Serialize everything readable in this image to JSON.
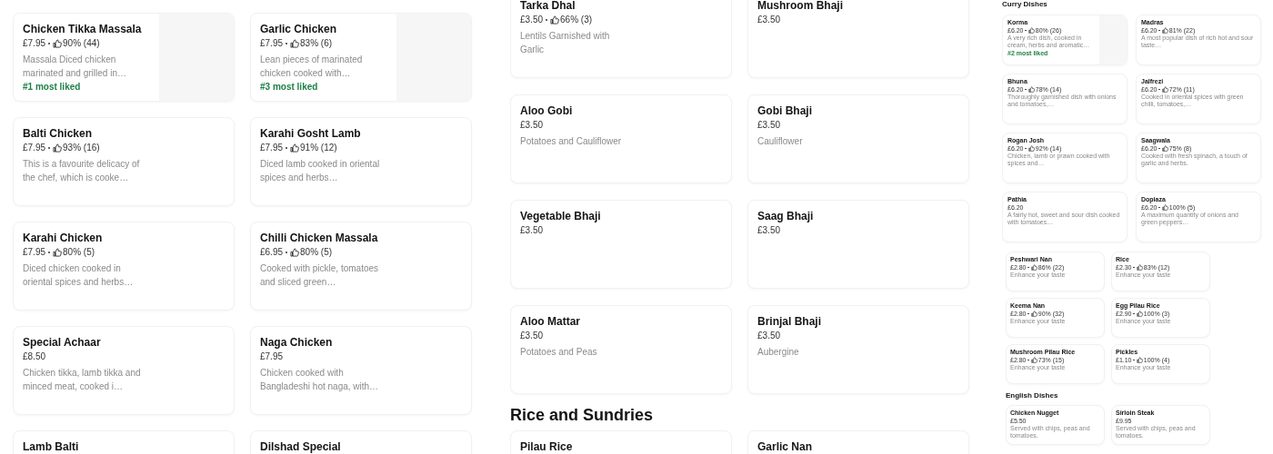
{
  "panels": [
    {
      "sections": [
        {
          "cards": [
            {
              "name": "Chicken Tikka Massala",
              "price": "£7.95",
              "rating": "90% (44)",
              "description": "Massala Diced chicken marinated and grilled in…",
              "badge": "#1 most liked",
              "photo": true
            },
            {
              "name": "Garlic Chicken",
              "price": "£7.95",
              "rating": "83% (6)",
              "description": "Lean pieces of marinated chicken cooked with…",
              "badge": "#3 most liked",
              "photo": true
            },
            {
              "name": "Balti Chicken",
              "price": "£7.95",
              "rating": "93% (16)",
              "description": "This is a favourite delicacy of the chef, which is cooke…"
            },
            {
              "name": "Karahi Gosht Lamb",
              "price": "£7.95",
              "rating": "91% (12)",
              "description": "Diced lamb cooked in oriental spices and herbs…"
            },
            {
              "name": "Karahi Chicken",
              "price": "£7.95",
              "rating": "80% (5)",
              "description": "Diced chicken cooked in oriental spices and herbs…"
            },
            {
              "name": "Chilli Chicken Massala",
              "price": "£6.95",
              "rating": "80% (5)",
              "description": "Cooked with pickle, tomatoes and sliced green…"
            },
            {
              "name": "Special Achaar",
              "price": "£8.50",
              "description": "Chicken tikka, lamb tikka and minced meat, cooked i…"
            },
            {
              "name": "Naga Chicken",
              "price": "£7.95",
              "description": "Chicken cooked with Bangladeshi hot naga, with…"
            },
            {
              "name": "Lamb Balti"
            },
            {
              "name": "Dilshad Special"
            }
          ]
        }
      ]
    },
    {
      "sections": [
        {
          "cards": [
            {
              "name": "Tarka Dhal",
              "price": "£3.50",
              "rating": "66% (3)",
              "description": "Lentils Garnished with Garlic"
            },
            {
              "name": "Mushroom Bhaji",
              "price": "£3.50"
            },
            {
              "name": "Aloo Gobi",
              "price": "£3.50",
              "description": "Potatoes and Cauliflower"
            },
            {
              "name": "Gobi Bhaji",
              "price": "£3.50",
              "description": "Cauliflower"
            },
            {
              "name": "Vegetable Bhaji",
              "price": "£3.50"
            },
            {
              "name": "Saag Bhaji",
              "price": "£3.50"
            },
            {
              "name": "Aloo Mattar",
              "price": "£3.50",
              "description": "Potatoes and Peas"
            },
            {
              "name": "Brinjal Bhaji",
              "price": "£3.50",
              "description": "Aubergine"
            }
          ]
        },
        {
          "heading": "Rice and Sundries",
          "cards": [
            {
              "name": "Pilau Rice"
            },
            {
              "name": "Garlic Nan"
            }
          ]
        }
      ]
    },
    {
      "sections": [
        {
          "heading": "Curry Dishes",
          "cards": [
            {
              "name": "Korma",
              "price": "£6.20",
              "rating": "80% (26)",
              "description": "A very rich dish, cooked in cream, herbs and aromatic…",
              "badge": "#2 most liked",
              "photo": true
            },
            {
              "name": "Madras",
              "price": "£6.20",
              "rating": "81% (22)",
              "description": "A most popular dish of rich hot and sour taste…"
            },
            {
              "name": "Bhuna",
              "price": "£6.20",
              "rating": "78% (14)",
              "description": "Thoroughly garnished dish with onions and tomatoes,…"
            },
            {
              "name": "Jalfrezi",
              "price": "£6.20",
              "rating": "72% (11)",
              "description": "Cooked in oriental spices with green chilli, tomatoes,…"
            },
            {
              "name": "Rogan Josh",
              "price": "£6.20",
              "rating": "92% (14)",
              "description": "Chicken, lamb or prawn cooked with spices and…"
            },
            {
              "name": "Saagwala",
              "price": "£6.20",
              "rating": "75% (8)",
              "description": "Cooked with fresh spinach, a touch of garlic and herbs."
            },
            {
              "name": "Pathia",
              "price": "£6.20",
              "description": "A fairly hot, sweet and sour dish cooked with tomatoes…"
            },
            {
              "name": "Dopiaza",
              "price": "£6.20",
              "rating": "100% (5)",
              "description": "A maximum quantity of onions and green peppers…"
            }
          ]
        }
      ]
    },
    {
      "sections": [
        {
          "cards": [
            {
              "name": "Peshwari Nan",
              "price": "£2.80",
              "rating": "86% (22)",
              "description": "Enhance your taste"
            },
            {
              "name": "Rice",
              "price": "£2.30",
              "rating": "83% (12)",
              "description": "Enhance your taste"
            },
            {
              "name": "Keema Nan",
              "price": "£2.80",
              "rating": "90% (32)",
              "description": "Enhance your taste"
            },
            {
              "name": "Egg Pilau Rice",
              "price": "£2.90",
              "rating": "100% (3)",
              "description": "Enhance your taste"
            },
            {
              "name": "Mushroom Pilau Rice",
              "price": "£2.80",
              "rating": "73% (15)",
              "description": "Enhance your taste"
            },
            {
              "name": "Pickles",
              "price": "£1.10",
              "rating": "100% (4)",
              "description": "Enhance your taste"
            }
          ]
        },
        {
          "heading": "English Dishes",
          "cards": [
            {
              "name": "Chicken Nugget",
              "price": "£5.50",
              "description": "Served with chips, peas and tomatoes."
            },
            {
              "name": "Sirloin Steak",
              "price": "£9.95",
              "description": "Served with chips, peas and tomatoes."
            }
          ]
        }
      ]
    }
  ]
}
